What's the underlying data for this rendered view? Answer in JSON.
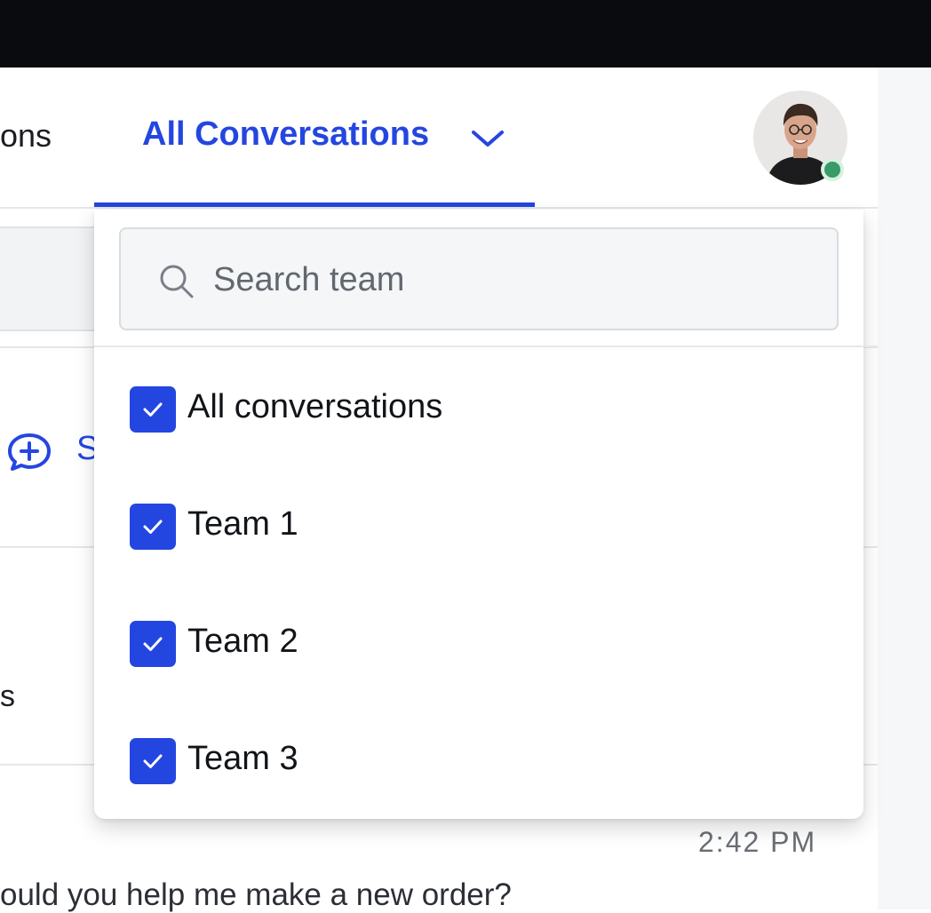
{
  "header": {
    "tab_partial_label": "ons",
    "active_tab_label": "All Conversations"
  },
  "colors": {
    "accent": "#2446e0",
    "presence_online": "#3a9a68",
    "topbar": "#0a0b0e"
  },
  "background": {
    "new_conversation_label_partial": "S",
    "list_item_text_partial": "s",
    "message_time": "2:42 PM",
    "message_preview": "ould you help me make a new order?"
  },
  "dropdown": {
    "search": {
      "placeholder": "Search team",
      "value": ""
    },
    "options": [
      {
        "label": "All conversations",
        "checked": true
      },
      {
        "label": "Team 1",
        "checked": true
      },
      {
        "label": "Team 2",
        "checked": true
      },
      {
        "label": "Team 3",
        "checked": true
      }
    ]
  },
  "icons": {
    "tab_dropdown": "chevron-down-icon",
    "search": "search-icon",
    "new_conversation": "chat-plus-icon",
    "checkbox": "checkmark-icon"
  }
}
